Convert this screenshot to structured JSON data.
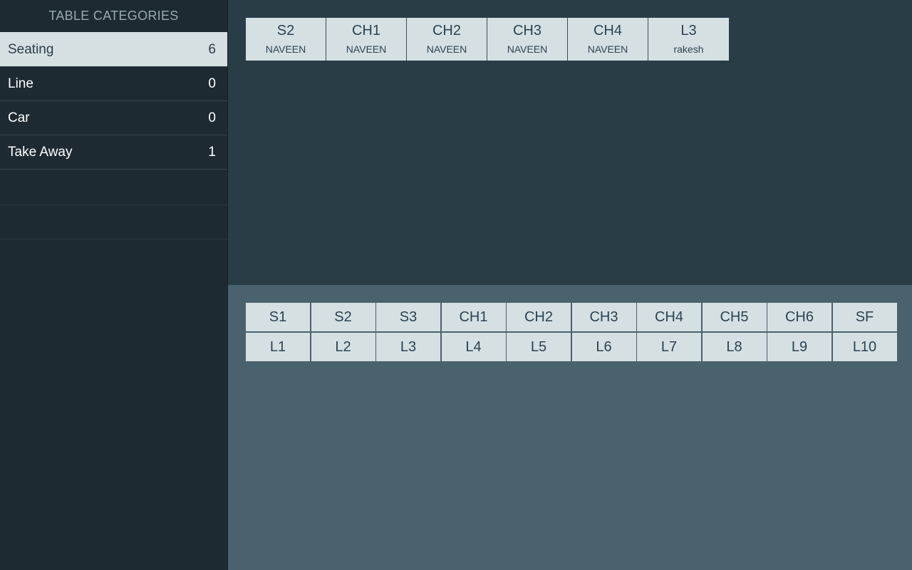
{
  "sidebar": {
    "title": "TABLE CATEGORIES",
    "categories": [
      {
        "label": "Seating",
        "count": "6",
        "active": true
      },
      {
        "label": "Line",
        "count": "0",
        "active": false
      },
      {
        "label": "Car",
        "count": "0",
        "active": false
      },
      {
        "label": "Take Away",
        "count": "1",
        "active": false
      }
    ]
  },
  "occupied": [
    {
      "table": "S2",
      "user": "NAVEEN"
    },
    {
      "table": "CH1",
      "user": "NAVEEN"
    },
    {
      "table": "CH2",
      "user": "NAVEEN"
    },
    {
      "table": "CH3",
      "user": "NAVEEN"
    },
    {
      "table": "CH4",
      "user": "NAVEEN"
    },
    {
      "table": "L3",
      "user": "rakesh"
    }
  ],
  "tables": [
    "S1",
    "S2",
    "S3",
    "CH1",
    "CH2",
    "CH3",
    "CH4",
    "CH5",
    "CH6",
    "SF",
    "L1",
    "L2",
    "L3",
    "L4",
    "L5",
    "L6",
    "L7",
    "L8",
    "L9",
    "L10"
  ],
  "colors": {
    "sidebar_bg": "#1d2a32",
    "top_panel_bg": "#293d47",
    "bottom_panel_bg": "#4a626d",
    "tile_bg": "#d5e0e3",
    "tile_text": "#2b4350"
  }
}
